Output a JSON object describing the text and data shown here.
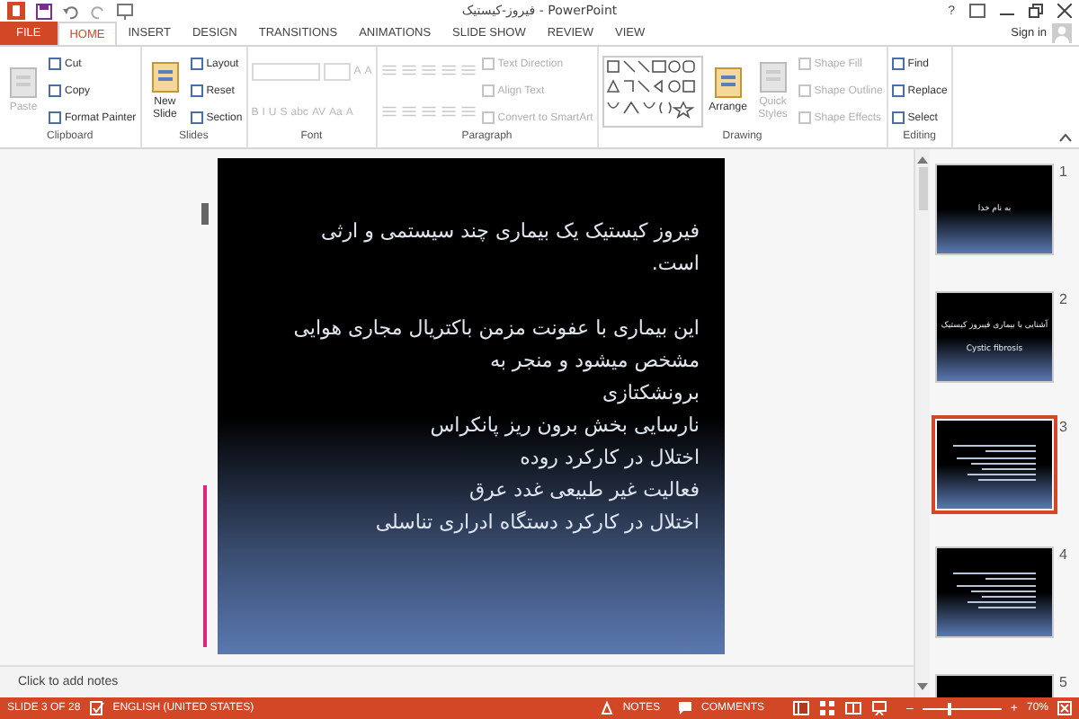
{
  "window": {
    "title": "فیروز-کیستیک - PowerPoint",
    "help": "?"
  },
  "tabs": [
    {
      "label": "FILE",
      "kind": "file",
      "selected": false
    },
    {
      "label": "HOME",
      "kind": "tab",
      "selected": true
    },
    {
      "label": "INSERT",
      "kind": "tab",
      "selected": false
    },
    {
      "label": "DESIGN",
      "kind": "tab",
      "selected": false
    },
    {
      "label": "TRANSITIONS",
      "kind": "tab",
      "selected": false
    },
    {
      "label": "ANIMATIONS",
      "kind": "tab",
      "selected": false
    },
    {
      "label": "SLIDE SHOW",
      "kind": "tab",
      "selected": false
    },
    {
      "label": "REVIEW",
      "kind": "tab",
      "selected": false
    },
    {
      "label": "VIEW",
      "kind": "tab",
      "selected": false
    }
  ],
  "account": {
    "label": "Sign in"
  },
  "ribbon": {
    "groups": [
      {
        "label": "Clipboard",
        "columns": [
          [
            [
              {
                "kind": "large",
                "label": "Paste",
                "disabled": true
              }
            ]
          ],
          [
            [
              {
                "kind": "small",
                "label": "Cut",
                "disabled": false
              }
            ],
            [
              {
                "kind": "small",
                "label": "Copy",
                "disabled": false
              }
            ],
            [
              {
                "kind": "small",
                "label": "Format Painter",
                "disabled": false
              }
            ]
          ]
        ]
      },
      {
        "label": "Slides",
        "columns": [
          [
            [
              {
                "kind": "large",
                "label": "New Slide",
                "disabled": false
              }
            ]
          ],
          [
            [
              {
                "kind": "small",
                "label": "Layout",
                "disabled": false
              }
            ],
            [
              {
                "kind": "small",
                "label": "Reset",
                "disabled": false
              }
            ],
            [
              {
                "kind": "small",
                "label": "Section",
                "disabled": false
              }
            ]
          ]
        ]
      },
      {
        "label": "Font",
        "columns": [
          [
            [
              {
                "kind": "combo"
              },
              {
                "kind": "combo"
              },
              {
                "kind": "glyph",
                "label": "A",
                "disabled": true
              },
              {
                "kind": "glyph",
                "label": "A",
                "disabled": true
              }
            ],
            [
              {
                "kind": "glyph",
                "label": "B",
                "disabled": true
              },
              {
                "kind": "glyph",
                "label": "I",
                "disabled": true
              },
              {
                "kind": "glyph",
                "label": "U",
                "disabled": true
              },
              {
                "kind": "glyph",
                "label": "S",
                "disabled": true
              },
              {
                "kind": "glyph",
                "label": "abc",
                "disabled": true
              },
              {
                "kind": "glyph",
                "label": "AV",
                "disabled": true
              },
              {
                "kind": "glyph",
                "label": "Aa",
                "disabled": true
              },
              {
                "kind": "glyph",
                "label": "A",
                "disabled": true
              }
            ]
          ]
        ]
      },
      {
        "label": "Paragraph",
        "columns": [
          [
            [
              {
                "kind": "icon",
                "disabled": true
              },
              {
                "kind": "icon",
                "disabled": true
              },
              {
                "kind": "icon",
                "disabled": true
              },
              {
                "kind": "icon",
                "disabled": true
              },
              {
                "kind": "icon",
                "disabled": true
              }
            ],
            [
              {
                "kind": "icon",
                "disabled": true
              },
              {
                "kind": "icon",
                "disabled": true
              },
              {
                "kind": "icon",
                "disabled": true
              },
              {
                "kind": "icon",
                "disabled": true
              },
              {
                "kind": "icon",
                "disabled": true
              }
            ]
          ],
          [
            [
              {
                "kind": "small",
                "label": "Text Direction",
                "disabled": true
              }
            ],
            [
              {
                "kind": "small",
                "label": "Align Text",
                "disabled": true
              }
            ],
            [
              {
                "kind": "small",
                "label": "Convert to SmartArt",
                "disabled": true
              }
            ]
          ]
        ]
      },
      {
        "label": "Drawing",
        "columns": [
          [
            [
              {
                "kind": "gallery"
              }
            ]
          ],
          [
            [
              {
                "kind": "large",
                "label": "Arrange",
                "disabled": false
              }
            ]
          ],
          [
            [
              {
                "kind": "large",
                "label": "Quick Styles",
                "disabled": true
              }
            ]
          ],
          [
            [
              {
                "kind": "small",
                "label": "Shape Fill",
                "disabled": true
              }
            ],
            [
              {
                "kind": "small",
                "label": "Shape Outline",
                "disabled": true
              }
            ],
            [
              {
                "kind": "small",
                "label": "Shape Effects",
                "disabled": true
              }
            ]
          ]
        ]
      },
      {
        "label": "Editing",
        "columns": [
          [
            [
              {
                "kind": "small",
                "label": "Find",
                "disabled": false
              }
            ],
            [
              {
                "kind": "small",
                "label": "Replace",
                "disabled": false
              }
            ],
            [
              {
                "kind": "small",
                "label": "Select",
                "disabled": false
              }
            ]
          ]
        ]
      }
    ]
  },
  "slide": {
    "paragraphs": [
      [
        "فیروز کیستیک یک بیماری چند سیستمی و ارثی است."
      ],
      [
        "این بیماری با عفونت مزمن باکتریال مجاری هوایی",
        "مشخص میشود و منجر به",
        "برونشکتازی",
        "نارسایی بخش برون ریز پانکراس",
        "اختلال در کارکرد روده",
        "فعالیت غیر طبیعی غدد عرق",
        "اختلال در کارکرد دستگاه ادراری تناسلی"
      ]
    ]
  },
  "notes": {
    "placeholder": "Click to add notes"
  },
  "thumbnails": [
    {
      "number": "1",
      "selected": false,
      "texts": [
        "به نام خدا"
      ]
    },
    {
      "number": "2",
      "selected": false,
      "texts": [
        "آشنایی با بیماری فیبروز کیستیک",
        "Cystic fibrosis"
      ]
    },
    {
      "number": "3",
      "selected": true,
      "kind": "lines"
    },
    {
      "number": "4",
      "selected": false,
      "kind": "lines"
    },
    {
      "number": "5",
      "selected": false
    }
  ],
  "status_bar": {
    "slide": "SLIDE 3 OF 28",
    "language": "ENGLISH (UNITED STATES)",
    "notes": "NOTES",
    "comments": "COMMENTS",
    "zoom": {
      "out": "–",
      "in": "+",
      "level": 0.33,
      "reading": "70%"
    }
  }
}
